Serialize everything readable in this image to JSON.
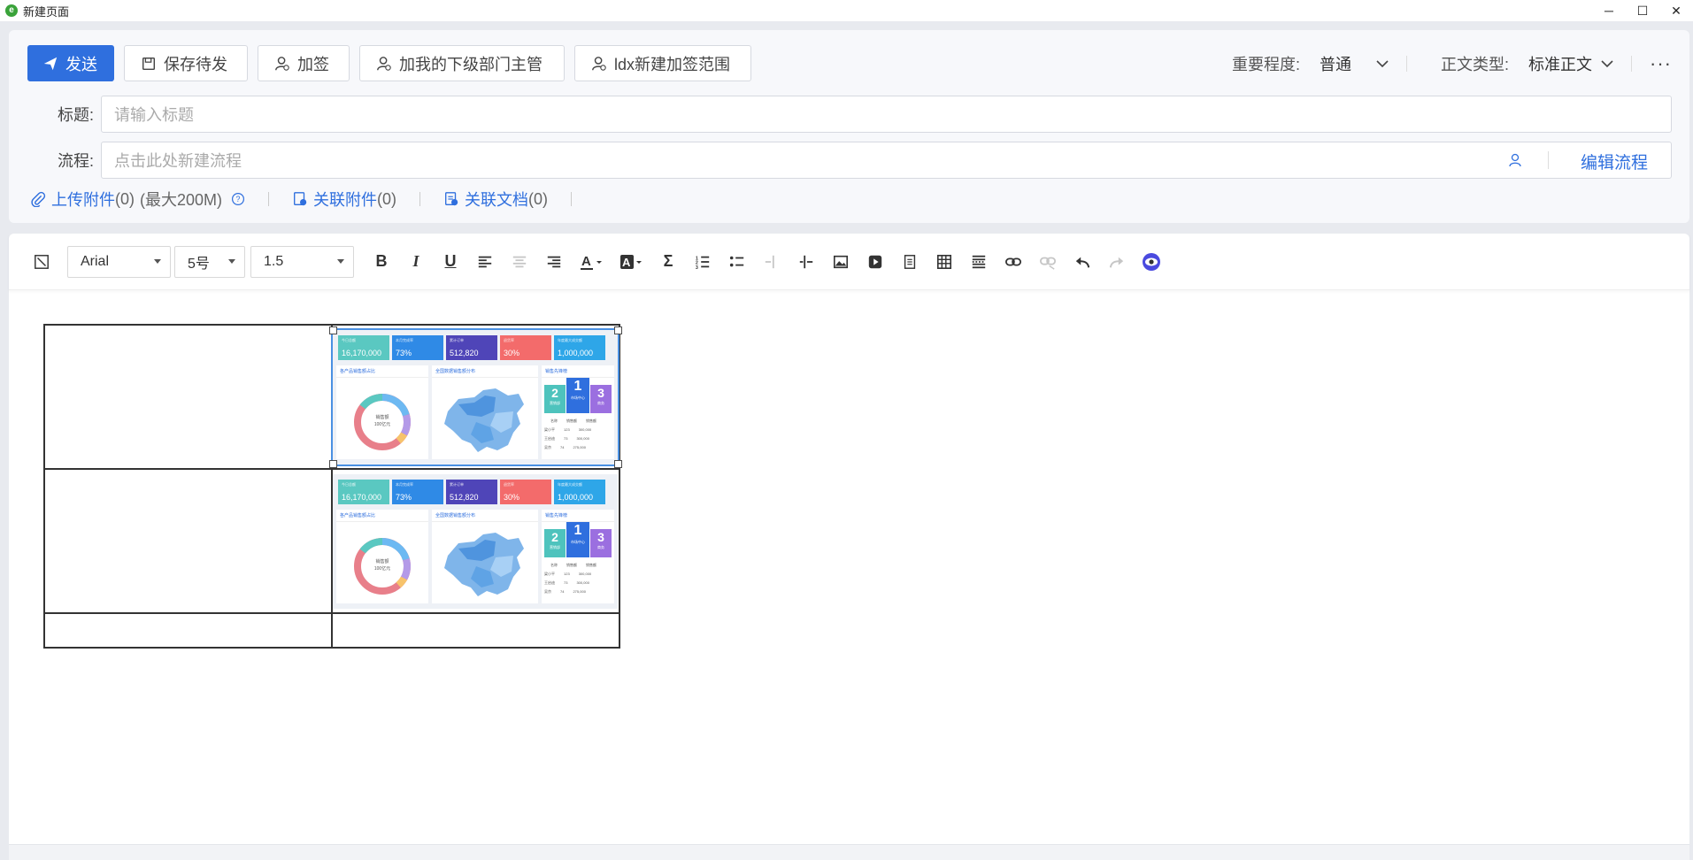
{
  "window": {
    "title": "新建页面",
    "minimize": "─",
    "maximize": "☐",
    "close": "✕"
  },
  "actions": {
    "send": "发送",
    "save_draft": "保存待发",
    "add_sign": "加签",
    "add_my_sub_manager": "加我的下级部门主管",
    "ldx_new_sign_scope": "ldx新建加签范围"
  },
  "options": {
    "importance_label": "重要程度:",
    "importance_value": "普通",
    "body_type_label": "正文类型:",
    "body_type_value": "标准正文",
    "more": "···"
  },
  "form": {
    "title_label": "标题:",
    "title_placeholder": "请输入标题",
    "flow_label": "流程:",
    "flow_placeholder": "点击此处新建流程",
    "edit_flow": "编辑流程"
  },
  "attachments": {
    "upload_label": "上传附件",
    "upload_count": "(0)",
    "upload_max": "(最大200M)",
    "related_attach_label": "关联附件",
    "related_attach_count": "(0)",
    "related_doc_label": "关联文档",
    "related_doc_count": "(0)"
  },
  "toolbar": {
    "font_family": "Arial",
    "font_size": "5号",
    "line_height": "1.5"
  },
  "dashboard": {
    "kpis": [
      {
        "label": "今日总额",
        "value": "16,170,000",
        "color": "#5ac8c1"
      },
      {
        "label": "本月完成率",
        "value": "73%",
        "color": "#2f8ae6"
      },
      {
        "label": "累计订单",
        "value": "512,820",
        "color": "#4f45b8"
      },
      {
        "label": "退货率",
        "value": "30%",
        "color": "#f36b6b"
      },
      {
        "label": "年度最大成交额",
        "value": "1,000,000",
        "color": "#2ea6e8"
      }
    ],
    "card1_title": "各产品销售额占比",
    "card2_title": "全国数据销售额分布",
    "card3_title": "销售先锋榜",
    "donut_label": "销售额",
    "donut_value": "100亿元",
    "ranks": [
      {
        "num": "2",
        "name": "营销部",
        "color": "#4ec3bd"
      },
      {
        "num": "1",
        "name": "市场中心",
        "color": "#2f6fde"
      },
      {
        "num": "3",
        "name": "商务",
        "color": "#9b6fe0"
      }
    ],
    "table_headers": [
      "名称",
      "销售额",
      "销售额"
    ],
    "table_rows": [
      [
        "梁小平",
        "123",
        "300,000"
      ],
      [
        "王启迪",
        "73",
        "300,000"
      ],
      [
        "吴京",
        "74",
        "275,000"
      ]
    ]
  }
}
